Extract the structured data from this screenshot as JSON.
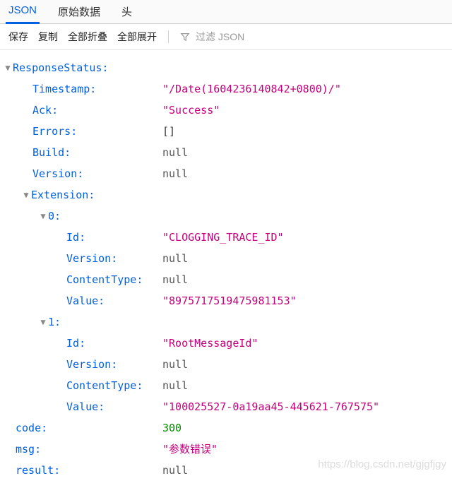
{
  "tabs": {
    "json": "JSON",
    "raw": "原始数据",
    "headers": "头"
  },
  "toolbar": {
    "save": "保存",
    "copy": "复制",
    "collapse": "全部折叠",
    "expand": "全部展开",
    "filter_placeholder": "过滤 JSON"
  },
  "tree": {
    "responseStatus": {
      "label": "ResponseStatus",
      "timestamp_k": "Timestamp",
      "timestamp_v": "\"/Date(1604236140842+0800)/\"",
      "ack_k": "Ack",
      "ack_v": "\"Success\"",
      "errors_k": "Errors",
      "errors_v": "[]",
      "build_k": "Build",
      "build_v": "null",
      "version_k": "Version",
      "version_v": "null",
      "extension_k": "Extension",
      "ext0": {
        "idx": "0",
        "id_k": "Id",
        "id_v": "\"CLOGGING_TRACE_ID\"",
        "version_k": "Version",
        "version_v": "null",
        "ct_k": "ContentType",
        "ct_v": "null",
        "val_k": "Value",
        "val_v": "\"8975717519475981153\""
      },
      "ext1": {
        "idx": "1",
        "id_k": "Id",
        "id_v": "\"RootMessageId\"",
        "version_k": "Version",
        "version_v": "null",
        "ct_k": "ContentType",
        "ct_v": "null",
        "val_k": "Value",
        "val_v": "\"100025527-0a19aa45-445621-767575\""
      }
    },
    "code_k": "code",
    "code_v": "300",
    "msg_k": "msg",
    "msg_v": "\"参数错误\"",
    "result_k": "result",
    "result_v": "null"
  },
  "watermark": "https://blog.csdn.net/gjgfjgy"
}
